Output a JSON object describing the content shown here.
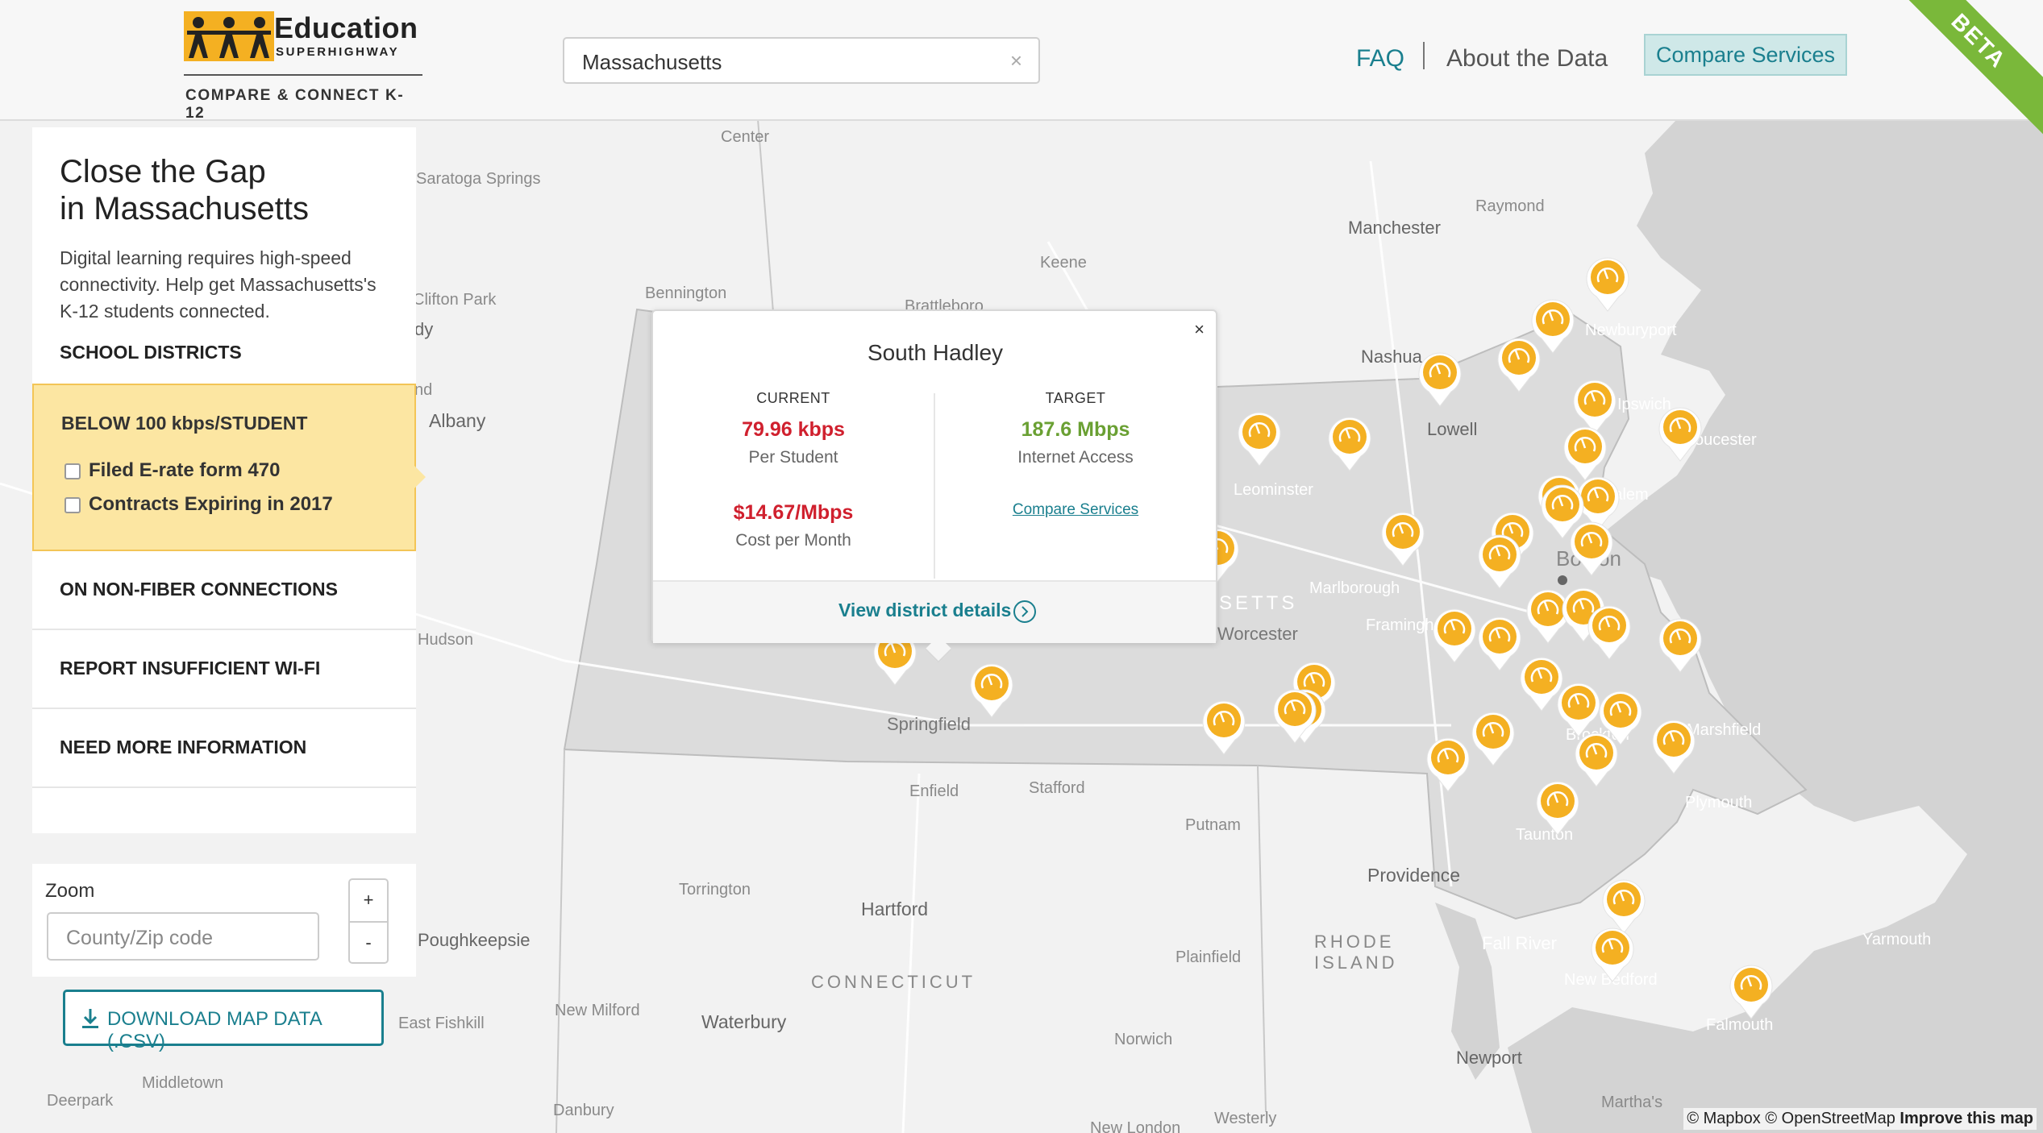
{
  "brand": {
    "title": "Education",
    "subtitle": "SUPERHIGHWAY",
    "tagline": "COMPARE & CONNECT K-12"
  },
  "search": {
    "value": "Massachusetts",
    "clear_label": "×"
  },
  "nav": {
    "faq": "FAQ",
    "about": "About the Data",
    "compare": "Compare Services",
    "beta": "BETA"
  },
  "sidebar": {
    "title_line1": "Close the Gap",
    "title_line2": "in Massachusetts",
    "description": "Digital learning requires high-speed connectivity. Help get Massachusetts's K-12 students connected.",
    "section_heading": "SCHOOL DISTRICTS",
    "active_item": {
      "label": "BELOW 100 kbps/STUDENT",
      "options": [
        "Filed E-rate form 470",
        "Contracts Expiring in 2017"
      ]
    },
    "items": [
      "ON NON-FIBER CONNECTIONS",
      "REPORT INSUFFICIENT WI-FI",
      "NEED MORE INFORMATION"
    ]
  },
  "zoom": {
    "label": "Zoom",
    "placeholder": "County/Zip code",
    "plus": "+",
    "minus": "-"
  },
  "download": {
    "label": "DOWNLOAD MAP DATA (.CSV)"
  },
  "popup": {
    "title": "South Hadley",
    "close": "×",
    "current": {
      "heading": "CURRENT",
      "speed": "79.96 kbps",
      "speed_caption": "Per Student",
      "cost": "$14.67/Mbps",
      "cost_caption": "Cost per Month"
    },
    "target": {
      "heading": "TARGET",
      "speed": "187.6 Mbps",
      "speed_caption": "Internet Access",
      "link": "Compare Services"
    },
    "footer_link": "View district details"
  },
  "map": {
    "state_labels": [
      "SETTS",
      "RHODE",
      "ISLAND",
      "CONNECTICUT"
    ],
    "places": [
      "Manchester",
      "Raymond",
      "Keene",
      "Bennington",
      "Brattleboro",
      "Nashua",
      "Lowell",
      "Newburyport",
      "Ipswich",
      "Gloucester",
      "Leominster",
      "Boston",
      "Salem",
      "Marlborough",
      "Worcester",
      "Framingham",
      "Springfield",
      "Enfield",
      "Stafford",
      "Putnam",
      "Brockton",
      "Marshfield",
      "Plymouth",
      "Taunton",
      "Providence",
      "Fall River",
      "New Bedford",
      "Yarmouth",
      "Falmouth",
      "Hartford",
      "Torrington",
      "Waterbury",
      "New Milford",
      "Newport",
      "Norwich",
      "Plainfield",
      "Westerly",
      "New London",
      "Danbury",
      "Middletown",
      "Deerpark",
      "East Fishkill",
      "Poughkeepsie",
      "Hudson",
      "Albany",
      "Schenectady",
      "Clifton Park",
      "Saratoga Springs",
      "Guilderland",
      "Center",
      "Martha's"
    ],
    "pin_color": "#f4b022",
    "accent": "#1a7f8e"
  },
  "attribution": {
    "mapbox": "© Mapbox",
    "osm": "© OpenStreetMap",
    "improve": "Improve this map"
  }
}
